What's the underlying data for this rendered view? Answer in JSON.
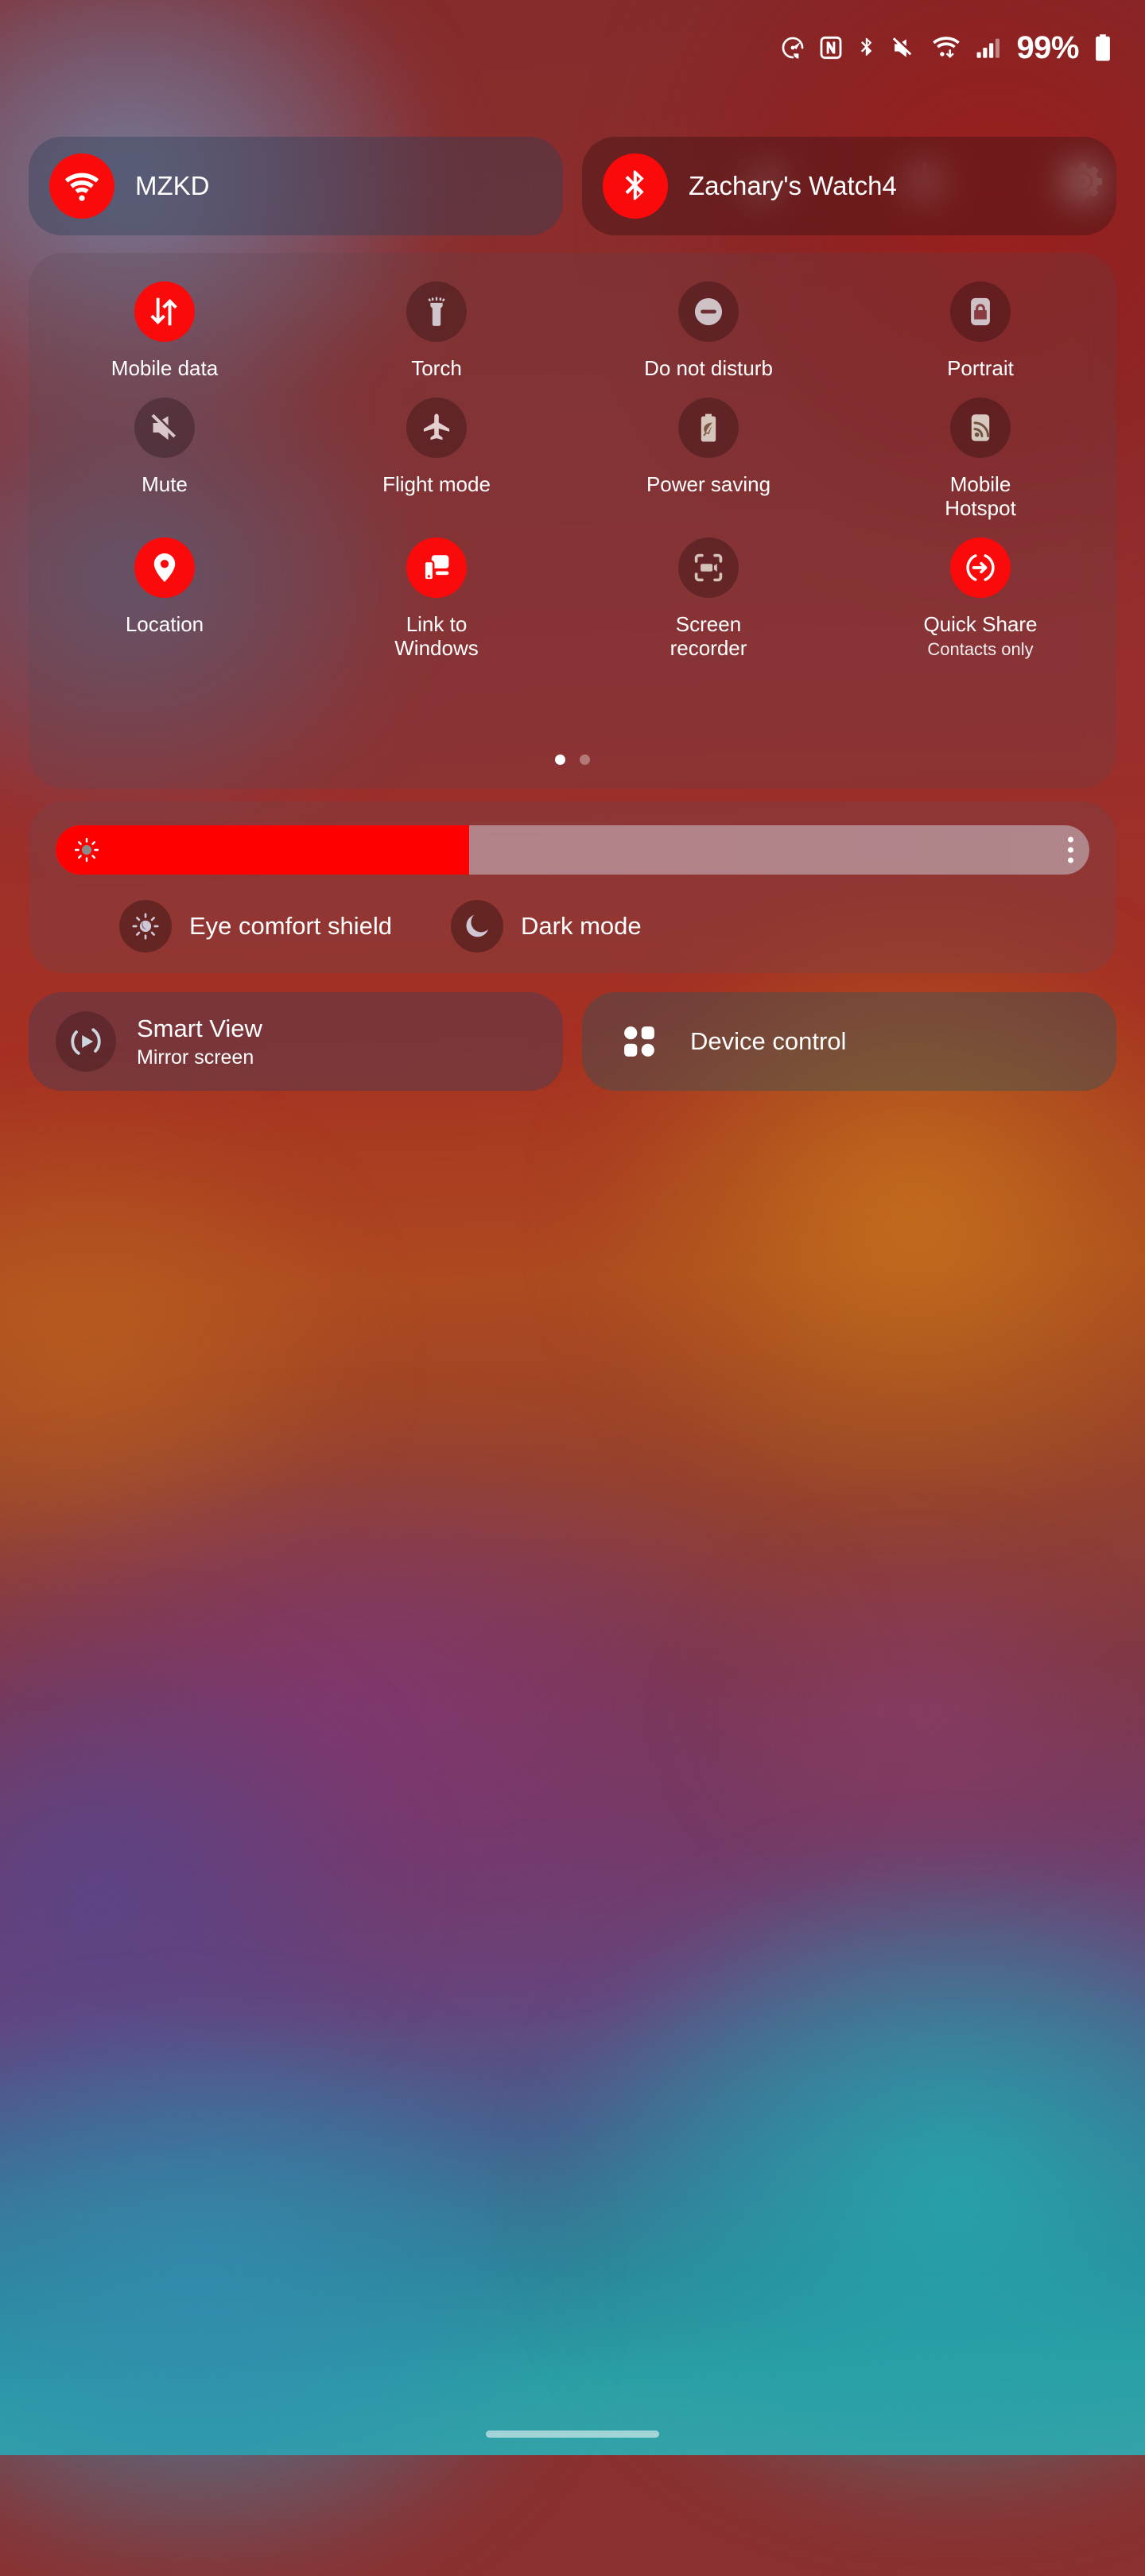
{
  "colors": {
    "accent_on": "#fa0a0a",
    "slider_fill": "#ff0000",
    "text": "#ffffff"
  },
  "status_bar": {
    "icons": [
      {
        "name": "data-saver-icon",
        "glyph": "data-saver"
      },
      {
        "name": "nfc-icon",
        "glyph": "N"
      },
      {
        "name": "bluetooth-icon",
        "glyph": "bluetooth"
      },
      {
        "name": "mute-icon",
        "glyph": "speaker-mute"
      },
      {
        "name": "wifi-icon",
        "glyph": "wifi-updown"
      },
      {
        "name": "signal-icon",
        "glyph": "signal-bars"
      }
    ],
    "battery_percent": "99%",
    "battery_icon": "battery-full-icon"
  },
  "header_actions": [
    {
      "name": "edit-button",
      "icon": "pencil-icon"
    },
    {
      "name": "power-button",
      "icon": "power-icon"
    },
    {
      "name": "settings-button",
      "icon": "gear-icon"
    }
  ],
  "connections": [
    {
      "name": "wifi-tile",
      "icon": "wifi-icon",
      "label": "MZKD",
      "active": true
    },
    {
      "name": "bluetooth-tile",
      "icon": "bluetooth-icon",
      "label": "Zachary's Watch4",
      "active": true
    }
  ],
  "toggles": [
    {
      "name": "mobile-data",
      "icon": "data-arrows-icon",
      "label": "Mobile data",
      "sub": "",
      "active": true
    },
    {
      "name": "torch",
      "icon": "flashlight-icon",
      "label": "Torch",
      "sub": "",
      "active": false
    },
    {
      "name": "do-not-disturb",
      "icon": "minus-circle-icon",
      "label": "Do not disturb",
      "sub": "",
      "active": false
    },
    {
      "name": "portrait",
      "icon": "rotation-lock-icon",
      "label": "Portrait",
      "sub": "",
      "active": false
    },
    {
      "name": "mute",
      "icon": "speaker-mute-icon",
      "label": "Mute",
      "sub": "",
      "active": false
    },
    {
      "name": "flight-mode",
      "icon": "airplane-icon",
      "label": "Flight mode",
      "sub": "",
      "active": false
    },
    {
      "name": "power-saving",
      "icon": "battery-leaf-icon",
      "label": "Power saving",
      "sub": "",
      "active": false
    },
    {
      "name": "mobile-hotspot",
      "icon": "hotspot-icon",
      "label": "Mobile Hotspot",
      "sub": "",
      "active": false
    },
    {
      "name": "location",
      "icon": "map-pin-icon",
      "label": "Location",
      "sub": "",
      "active": true
    },
    {
      "name": "link-to-windows",
      "icon": "link-windows-icon",
      "label": "Link to Windows",
      "sub": "",
      "active": true
    },
    {
      "name": "screen-recorder",
      "icon": "screen-record-icon",
      "label": "Screen recorder",
      "sub": "",
      "active": false
    },
    {
      "name": "quick-share",
      "icon": "quick-share-icon",
      "label": "Quick Share",
      "sub": "Contacts only",
      "active": true
    }
  ],
  "pagination": {
    "pages": 2,
    "current": 1
  },
  "brightness": {
    "name": "brightness-slider",
    "value_percent": 40,
    "sun_icon": "sun-icon",
    "menu_icon": "more-vertical-icon"
  },
  "display_modes": [
    {
      "name": "eye-comfort-shield",
      "icon": "eye-comfort-icon",
      "label": "Eye comfort shield",
      "active": false
    },
    {
      "name": "dark-mode",
      "icon": "moon-icon",
      "label": "Dark mode",
      "active": false
    }
  ],
  "bottom_tiles": [
    {
      "name": "smart-view-tile",
      "icon": "smart-view-icon",
      "title": "Smart View",
      "sub": "Mirror screen"
    },
    {
      "name": "device-control-tile",
      "icon": "device-control-icon",
      "title": "Device control",
      "sub": ""
    }
  ]
}
